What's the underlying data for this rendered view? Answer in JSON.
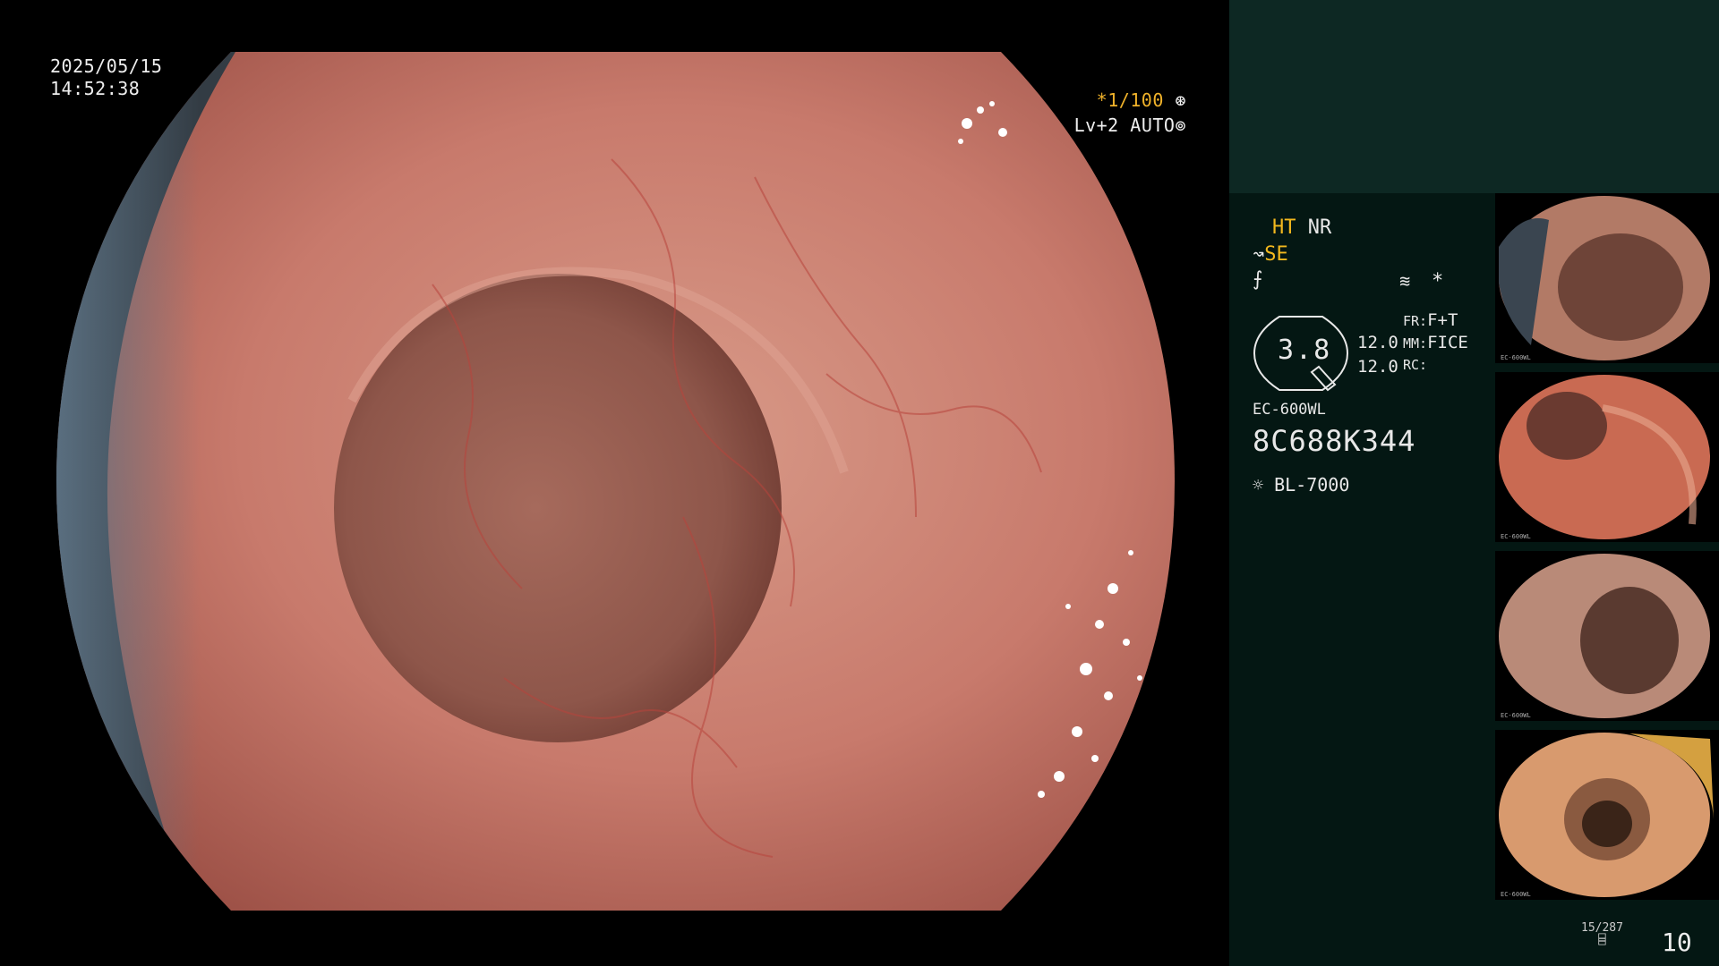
{
  "overlay": {
    "date": "2025/05/15",
    "time": "14:52:38",
    "shutter_star": "*",
    "shutter": "1/100",
    "level": "Lv+2",
    "iris_mode": "AUTO"
  },
  "panel": {
    "ht": "HT",
    "nr": "NR",
    "se": "SE",
    "star": "*",
    "gauge_value": "3.8",
    "val1": "12.0",
    "val2": "12.0",
    "fr_label": "FR:",
    "fr_value": "F+T",
    "mm_label": "MM:",
    "mm_value": "FICE",
    "rc_label": "RC:",
    "scope_model": "EC-600WL",
    "serial": "8C688K344",
    "light_source": "BL-7000"
  },
  "thumbnails": [
    {
      "label": "EC-600WL"
    },
    {
      "label": "EC-600WL"
    },
    {
      "label": "EC-600WL"
    },
    {
      "label": "EC-600WL"
    }
  ],
  "footer": {
    "counter": "15/287",
    "number": "10"
  },
  "colors": {
    "panel_bg": "#041713",
    "panel_top": "#0d2823",
    "accent_yellow": "#f3b81e",
    "mucosa": "#c9786b"
  },
  "icons": [
    "aperture-icon",
    "brightness-icon",
    "scope-icon",
    "signal-icon",
    "menu-icon",
    "sun-icon",
    "storage-icon"
  ]
}
